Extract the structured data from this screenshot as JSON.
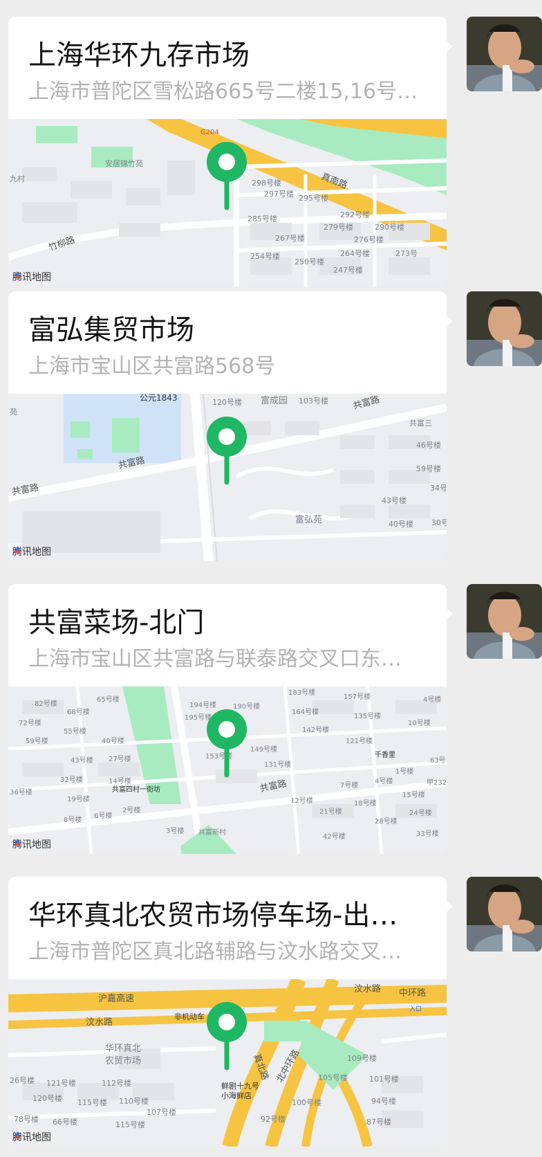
{
  "messages": [
    {
      "title": "上海华环九存市场",
      "address": "上海市普陀区雪松路665号二楼15,16号…",
      "map_labels": [
        "G204",
        "安居锦竹苑",
        "298号楼",
        "297号楼",
        "295号楼",
        "真南路",
        "285号楼",
        "292号楼",
        "279号楼",
        "290号楼",
        "267号楼",
        "276号楼",
        "254号楼",
        "250号楼",
        "264号楼",
        "273号",
        "247号楼",
        "竹柳路",
        "九村"
      ],
      "watermark": "腾讯地图"
    },
    {
      "title": "富弘集贸市场",
      "address": "上海市宝山区共富路568号",
      "map_labels": [
        "公元1843",
        "120号楼",
        "富成园",
        "103号楼",
        "共富路",
        "共富三",
        "46号楼",
        "59号楼",
        "34号",
        "43号楼",
        "40号楼",
        "30号",
        "共富路",
        "共富路",
        "富弘苑",
        "苑"
      ],
      "watermark": "腾讯地图"
    },
    {
      "title": "共富菜场-北门",
      "address": "上海市宝山区共富路与联泰路交叉口东…",
      "map_labels": [
        "183号楼",
        "157号楼",
        "4号楼",
        "82号楼",
        "65号楼",
        "194号楼",
        "190号楼",
        "164号楼",
        "135号楼",
        "10号楼",
        "68号楼",
        "195号楼",
        "142号楼",
        "72号楼",
        "55号楼",
        "121号楼",
        "59号楼",
        "40号楼",
        "149号楼",
        "千香里",
        "43号楼",
        "27号楼",
        "153号楼",
        "131号楼",
        "63号",
        "1号楼",
        "32号楼",
        "14号楼",
        "共富四村一街坊",
        "7号楼",
        "4号楼",
        "甲232",
        "36号楼",
        "19号楼",
        "共富路",
        "15号楼",
        "12号楼",
        "18号楼",
        "8号楼",
        "6号楼",
        "2号楼",
        "21号楼",
        "24号楼",
        "3号楼",
        "共富新村",
        "42号楼",
        "28号楼",
        "33号楼"
      ],
      "watermark": "腾讯地图"
    },
    {
      "title": "华环真北农贸市场停车场-出…",
      "address": "上海市普陀区真北路辅路与汶水路交叉…",
      "map_labels": [
        "沪嘉高速",
        "汶水路",
        "中环路",
        "汶水路",
        "非机动车",
        "华环真北",
        "农贸市场",
        "真北路",
        "北中环路",
        "109号楼",
        "26号楼",
        "121号楼",
        "112号楼",
        "105号楼",
        "101号楼",
        "鲜剧十九号",
        "小海鲜店",
        "120号楼",
        "115号楼",
        "110号楼",
        "107号楼",
        "100号楼",
        "94号楼",
        "78号楼",
        "66号楼",
        "115号楼",
        "92号楼",
        "87号楼",
        "入口"
      ],
      "watermark": "腾讯地图"
    }
  ],
  "colors": {
    "pin": "#1fb764",
    "road_major": "#f7c442",
    "park": "#a8ebc1",
    "water": "#cfe2f7"
  }
}
